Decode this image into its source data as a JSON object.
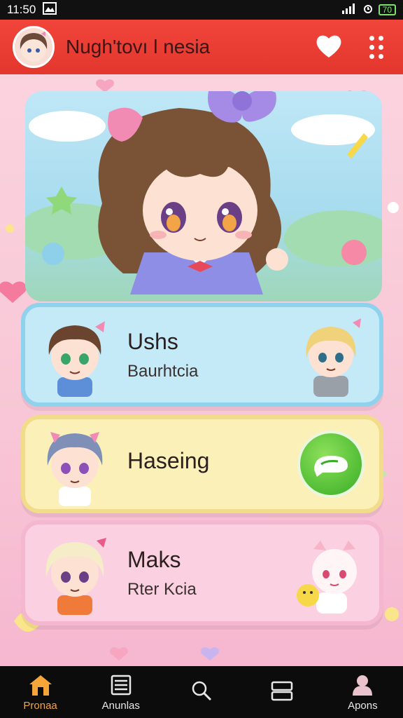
{
  "status_bar": {
    "time": "11:50",
    "battery": "70"
  },
  "app_bar": {
    "title": "Nugh'tovı l nesia"
  },
  "colors": {
    "accent": "#e3372e",
    "nav_active": "#f5a53a",
    "green": "#36ad25"
  },
  "cards": [
    {
      "title": "Ushs",
      "subtitle": "Baurhtcia",
      "right": "chibi-girl-avatar"
    },
    {
      "title": "Haseing",
      "subtitle": "",
      "right": "green-chat-button"
    },
    {
      "title": "Maks",
      "subtitle": "Rter Kcia",
      "right": "chibi-plush-avatar"
    }
  ],
  "bottom_nav": [
    {
      "label": "Pronaa",
      "icon": "home-icon",
      "active": true
    },
    {
      "label": "Anunlas",
      "icon": "list-icon",
      "active": false
    },
    {
      "label": "",
      "icon": "search-icon",
      "active": false
    },
    {
      "label": "",
      "icon": "cards-icon",
      "active": false
    },
    {
      "label": "Apons",
      "icon": "profile-icon",
      "active": false
    }
  ]
}
